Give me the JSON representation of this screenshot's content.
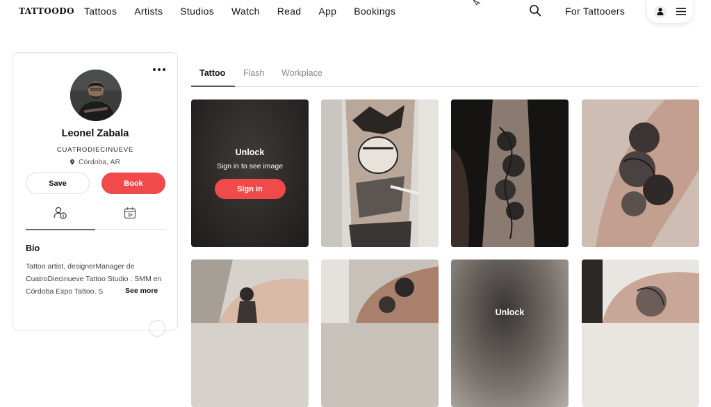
{
  "header": {
    "logo": "TATTOODO",
    "nav": [
      "Tattoos",
      "Artists",
      "Studios",
      "Watch",
      "Read",
      "App",
      "Bookings"
    ],
    "for_tattooers": "For Tattooers",
    "search_icon": "search-icon",
    "user_icon": "user-icon",
    "menu_icon": "hamburger-icon"
  },
  "profile": {
    "name": "Leonel Zabala",
    "studio": "CUATRODIECINUEVE",
    "location": "Córdoba, AR",
    "save_label": "Save",
    "book_label": "Book",
    "tabs": [
      "info-icon",
      "calendar-icon"
    ],
    "bio_title": "Bio",
    "bio_text": "Tattoo artist, designerManager de CuatroDiecinueve Tattoo Studio . SMM en Córdoba Expo Tattoo. S",
    "see_more": "See more"
  },
  "gallery": {
    "tabs": [
      "Tattoo",
      "Flash",
      "Workplace"
    ],
    "active_tab": "Tattoo",
    "lock": {
      "title": "Unlock",
      "subtitle": "Sign in to see image",
      "button": "Sign in"
    }
  },
  "colors": {
    "accent": "#f14a4a"
  }
}
